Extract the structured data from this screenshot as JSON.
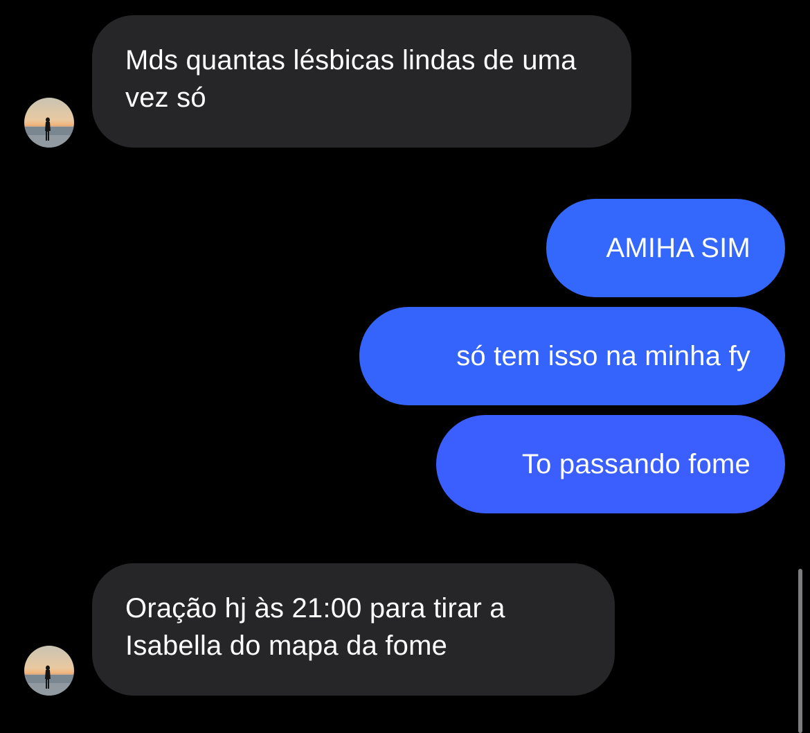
{
  "conversation": {
    "messages": [
      {
        "direction": "incoming",
        "text": "Mds quantas lésbicas lindas de uma vez só"
      },
      {
        "direction": "outgoing",
        "text": "AMIHA SIM"
      },
      {
        "direction": "outgoing",
        "text": "só tem isso na minha fy"
      },
      {
        "direction": "outgoing",
        "text": "To passando fome"
      },
      {
        "direction": "incoming",
        "text": "Oração hj às 21:00 para tirar a Isabella do mapa da fome"
      }
    ]
  },
  "colors": {
    "background": "#000000",
    "incoming_bubble": "#262628",
    "outgoing_bubble": "#3467fb",
    "text": "#ffffff"
  },
  "icons": {
    "avatar": "sunset-beach-silhouette-avatar"
  }
}
